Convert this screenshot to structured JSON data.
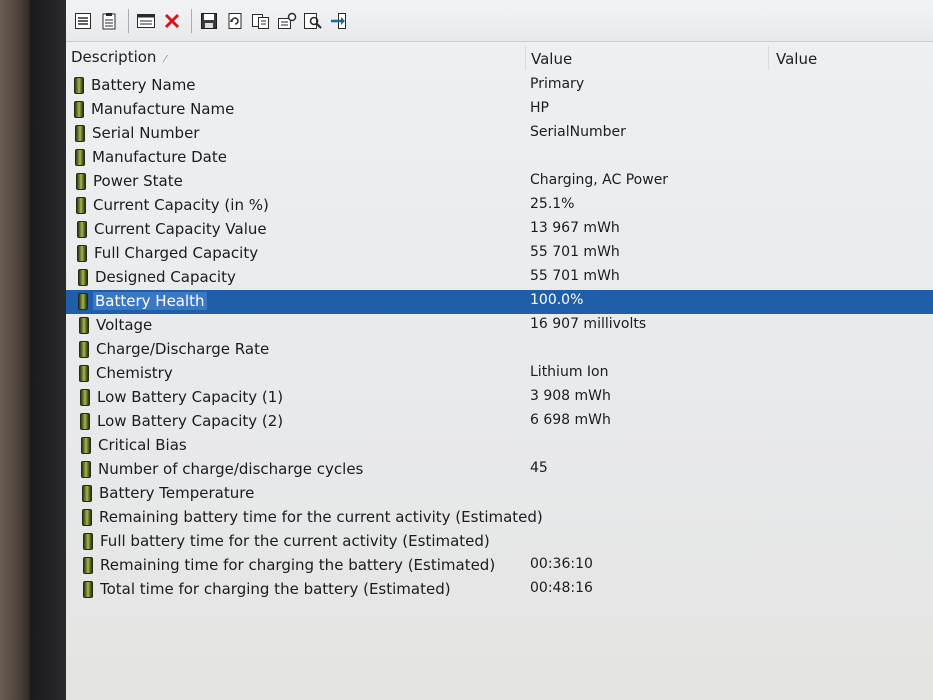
{
  "header": {
    "description": "Description",
    "value1": "Value",
    "value2": "Value"
  },
  "toolbar": {
    "buttons": [
      "details-icon",
      "report-icon",
      "properties-icon",
      "delete-icon",
      "save-icon",
      "refresh-icon",
      "copy-icon",
      "options-icon",
      "find-icon",
      "exit-icon"
    ],
    "accent": "#1f5ea9"
  },
  "rows": [
    {
      "desc": "Battery Name",
      "value": "Primary"
    },
    {
      "desc": "Manufacture Name",
      "value": "HP"
    },
    {
      "desc": "Serial Number",
      "value": "SerialNumber"
    },
    {
      "desc": "Manufacture Date",
      "value": ""
    },
    {
      "desc": "Power State",
      "value": "Charging, AC Power"
    },
    {
      "desc": "Current Capacity (in %)",
      "value": "25.1%"
    },
    {
      "desc": "Current Capacity Value",
      "value": "13 967 mWh"
    },
    {
      "desc": "Full Charged Capacity",
      "value": "55 701 mWh"
    },
    {
      "desc": "Designed Capacity",
      "value": "55 701 mWh"
    },
    {
      "desc": "Battery Health",
      "value": "100.0%",
      "selected": true
    },
    {
      "desc": "Voltage",
      "value": "16 907 millivolts"
    },
    {
      "desc": "Charge/Discharge Rate",
      "value": ""
    },
    {
      "desc": "Chemistry",
      "value": "Lithium Ion"
    },
    {
      "desc": "Low Battery Capacity (1)",
      "value": "3 908 mWh"
    },
    {
      "desc": "Low Battery Capacity (2)",
      "value": "6 698 mWh"
    },
    {
      "desc": "Critical Bias",
      "value": ""
    },
    {
      "desc": "Number of charge/discharge cycles",
      "value": "45"
    },
    {
      "desc": "Battery Temperature",
      "value": ""
    },
    {
      "desc": "Remaining battery time for the current activity (Estimated)",
      "value": ""
    },
    {
      "desc": "Full battery time for the current activity (Estimated)",
      "value": ""
    },
    {
      "desc": "Remaining time for charging the battery (Estimated)",
      "value": "00:36:10"
    },
    {
      "desc": "Total  time for charging the battery (Estimated)",
      "value": "00:48:16"
    }
  ]
}
